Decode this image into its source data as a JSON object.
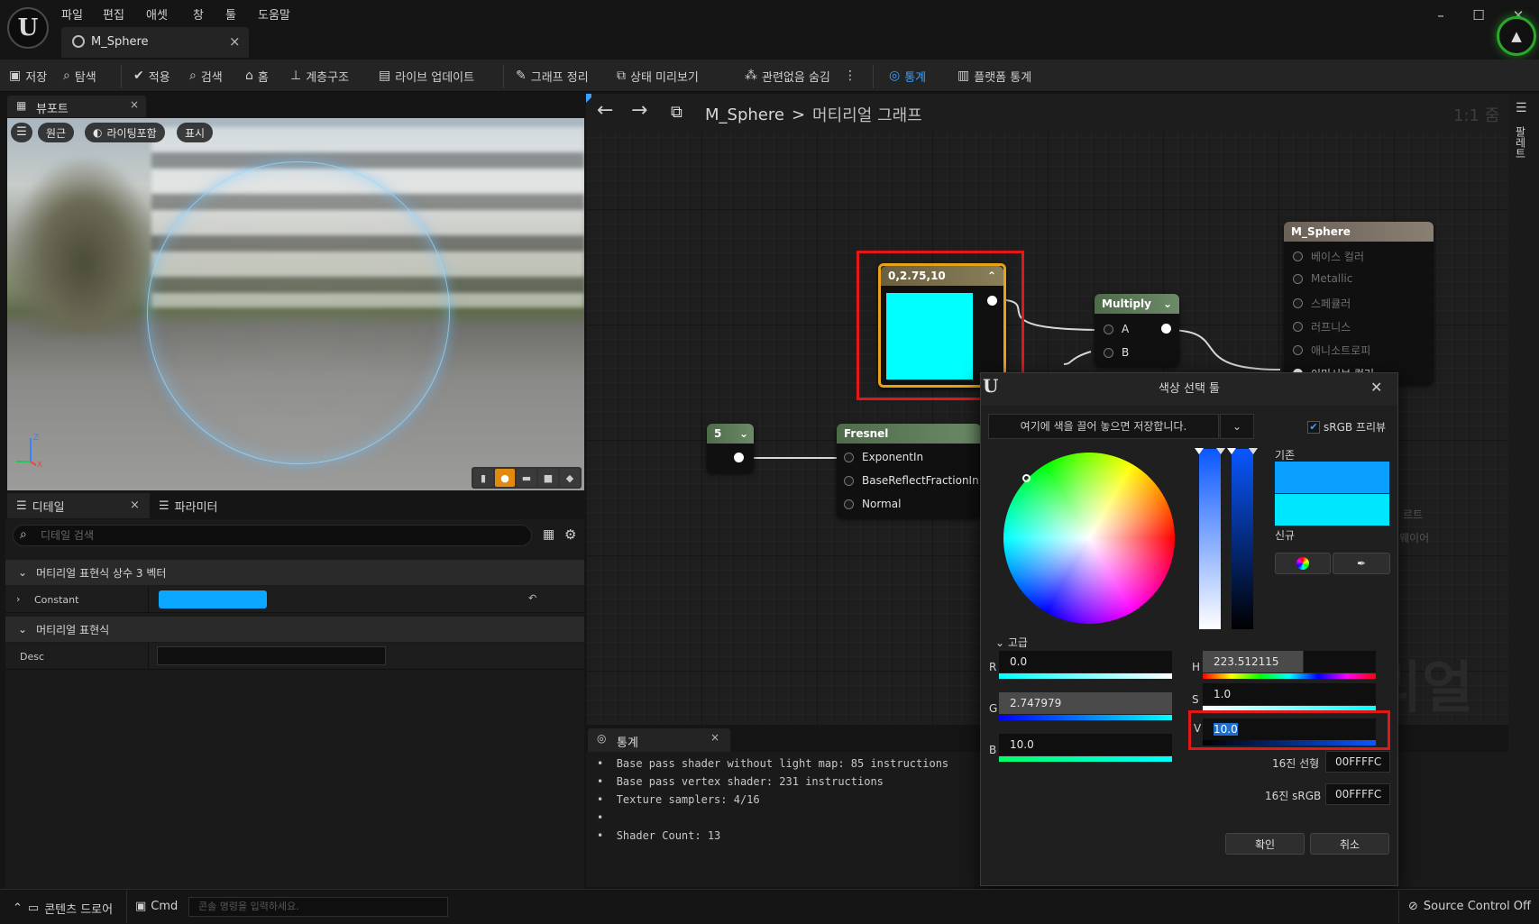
{
  "menu": [
    "파일",
    "편집",
    "애셋",
    "창",
    "툴",
    "도움말"
  ],
  "document_tab": {
    "label": "M_Sphere",
    "close": "×"
  },
  "window_controls": {
    "minimize": "–",
    "maximize": "☐",
    "close": "✕"
  },
  "toolbar": {
    "save": "저장",
    "browse": "탐색",
    "apply": "적용",
    "search": "검색",
    "home": "홈",
    "hierarchy": "계층구조",
    "live_update": "라이브 업데이트",
    "clean_graph": "그래프 정리",
    "preview_state": "상태 미리보기",
    "hide_unrelated": "관련없음 숨김",
    "stats": "통계",
    "platform_stats": "플랫폼 통계"
  },
  "viewport": {
    "tab_label": "뷰포트",
    "tab_close": "×",
    "perspective": "원근",
    "lighting": "라이팅포함",
    "show": "표시",
    "axis_z": "Z",
    "axis_x": "X",
    "preview_shapes": [
      "cylinder",
      "sphere",
      "plane",
      "cube",
      "custom-mesh"
    ],
    "selected_shape": "sphere"
  },
  "details": {
    "tab_details": "디테일",
    "tab_close": "×",
    "tab_params": "파라미터",
    "search_placeholder": "디테일 검색",
    "section1": "머티리얼 표현식 상수 3 벡터",
    "constant_label": "Constant",
    "constant_color": "#0aa6ff",
    "section2": "머티리얼 표현식",
    "desc_label": "Desc",
    "desc_value": ""
  },
  "graph": {
    "breadcrumb_asset": "M_Sphere",
    "breadcrumb_sep": ">",
    "breadcrumb_graph": "머티리얼 그래프",
    "zoom": "1:1 줌",
    "palette": "팔레트",
    "watermark": "리얼",
    "nodes": {
      "vector": {
        "title": "0,2.75,10",
        "color": "#00ffff"
      },
      "multiply": {
        "title": "Multiply",
        "pin_a": "A",
        "pin_b": "B"
      },
      "scalar": {
        "title": "5"
      },
      "fresnel": {
        "title": "Fresnel",
        "pins": [
          "ExponentIn",
          "BaseReflectFractionIn",
          "Normal"
        ]
      },
      "result": {
        "title": "M_Sphere",
        "pins": [
          "베이스 컬러",
          "Metallic",
          "스페큘러",
          "러프니스",
          "애니소트로피",
          "이미시브 컬러"
        ],
        "hidden_fragments": [
          "르트",
          "웨이어"
        ]
      }
    }
  },
  "stats": {
    "tab_label": "통계",
    "tab_close": "×",
    "lines": [
      "Base pass shader without light map: 85 instructions",
      "Base pass vertex shader: 231 instructions",
      "Texture samplers: 4/16",
      "",
      "Shader Count: 13"
    ]
  },
  "color_picker": {
    "title": "색상 선택 툴",
    "close": "✕",
    "theme_drop": "여기에 색을 끌어 놓으면 저장합니다.",
    "srgb_label": "sRGB 프리뷰",
    "srgb_checked": true,
    "old_label": "기존",
    "new_label": "신규",
    "old_color": "#0aa0ff",
    "new_color": "#00e6ff",
    "advanced_label": "고급",
    "r_label": "R",
    "r_value": "0.0",
    "g_label": "G",
    "g_value": "2.747979",
    "b_label": "B",
    "b_value": "10.0",
    "h_label": "H",
    "h_value": "223.512115",
    "s_label": "S",
    "s_value": "1.0",
    "v_label": "V",
    "v_value": "10.0",
    "hex_linear_label": "16진 선형",
    "hex_linear_value": "00FFFFC",
    "hex_srgb_label": "16진 sRGB",
    "hex_srgb_value": "00FFFFC",
    "ok": "확인",
    "cancel": "취소"
  },
  "statusbar": {
    "content_drawer": "콘텐츠 드로어",
    "cmd": "Cmd",
    "cmd_placeholder": "콘솔 명령을 입력하세요.",
    "source_control": "Source Control Off"
  }
}
